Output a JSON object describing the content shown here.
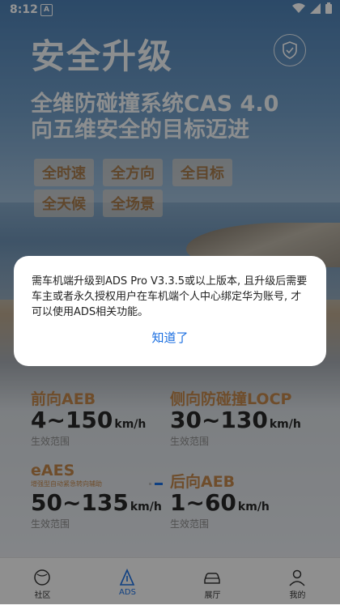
{
  "status_bar": {
    "time": "8:12",
    "notif_icon_letter": "A"
  },
  "header": {
    "title": "安全升级"
  },
  "hero": {
    "line1": "全维防碰撞系统CAS 4.0",
    "line2": "向五维安全的目标迈进",
    "tags": [
      "全时速",
      "全方向",
      "全目标",
      "全天候",
      "全场景"
    ]
  },
  "features": [
    {
      "title": "前向AEB",
      "value": "4~150",
      "unit": "km/h",
      "label": "生效范围",
      "subtitle": ""
    },
    {
      "title": "侧向防碰撞LOCP",
      "value": "30~130",
      "unit": "km/h",
      "label": "生效范围",
      "subtitle": ""
    },
    {
      "title": "eAES",
      "value": "50~135",
      "unit": "km/h",
      "label": "生效范围",
      "subtitle": "增强型自动紧急转向辅助"
    },
    {
      "title": "后向AEB",
      "value": "1~60",
      "unit": "km/h",
      "label": "生效范围",
      "subtitle": ""
    }
  ],
  "dialog": {
    "message": "需车机端升级到ADS Pro V3.3.5或以上版本, 且升级后需要车主或者永久授权用户在车机端个人中心绑定华为账号, 才可以使用ADS相关功能。",
    "confirm_label": "知道了"
  },
  "tabbar": {
    "items": [
      {
        "label": "社区",
        "icon": "community-icon"
      },
      {
        "label": "ADS",
        "icon": "ads-icon"
      },
      {
        "label": "展厅",
        "icon": "car-icon"
      },
      {
        "label": "我的",
        "icon": "person-icon"
      }
    ],
    "active": "ADS"
  },
  "colors": {
    "accent": "#1a6ee0",
    "feature_title": "#c0864a"
  }
}
